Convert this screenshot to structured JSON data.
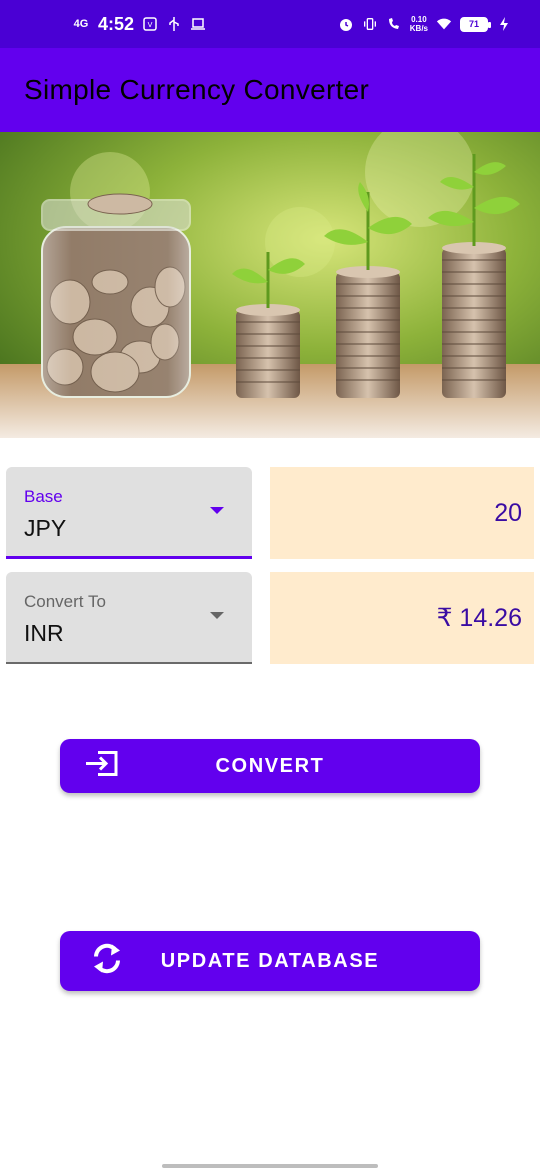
{
  "status_bar": {
    "network": "4G",
    "time": "4:52",
    "data_speed_value": "0.10",
    "data_speed_unit": "KB/s",
    "battery": "71",
    "icons": [
      "signal-icon",
      "volte-icon",
      "usb-icon",
      "laptop-icon",
      "alarm-icon",
      "vibrate-icon",
      "wifi-calling-icon",
      "wifi-icon",
      "charging-icon"
    ]
  },
  "app_bar": {
    "title": "Simple Currency Converter"
  },
  "hero_image": {
    "subject": "coin-jar-and-plant-stacks"
  },
  "converter": {
    "base": {
      "label": "Base",
      "value": "JPY"
    },
    "convert_to": {
      "label": "Convert To",
      "value": "INR"
    },
    "amount": "20",
    "result": "₹ 14.26"
  },
  "buttons": {
    "convert": {
      "label": "CONVERT",
      "icon": "input-arrow-icon"
    },
    "update": {
      "label": "UPDATE DATABASE",
      "icon": "sync-icon"
    }
  },
  "colors": {
    "status_bar": "#4a00d4",
    "primary": "#6200ee",
    "value_box": "#ffebcd",
    "dropdown_bg": "#e0e0e0"
  }
}
